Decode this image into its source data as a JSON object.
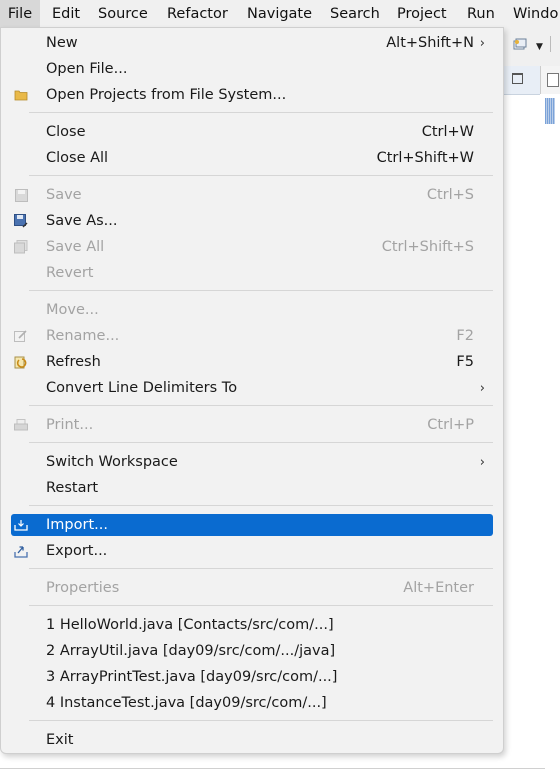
{
  "menubar": {
    "items": [
      "File",
      "Edit",
      "Source",
      "Refactor",
      "Navigate",
      "Search",
      "Project",
      "Run",
      "Windo"
    ]
  },
  "menu": {
    "items": [
      {
        "label": "New",
        "shortcut": "Alt+Shift+N",
        "arrow": "›"
      },
      {
        "label": "Open File..."
      },
      {
        "label": "Open Projects from File System...",
        "icon": "folder-icon"
      },
      {
        "label": "Close",
        "shortcut": "Ctrl+W"
      },
      {
        "label": "Close All",
        "shortcut": "Ctrl+Shift+W"
      },
      {
        "label": "Save",
        "shortcut": "Ctrl+S",
        "icon": "save-icon",
        "disabled": true
      },
      {
        "label": "Save As...",
        "icon": "save-as-icon"
      },
      {
        "label": "Save All",
        "shortcut": "Ctrl+Shift+S",
        "icon": "save-all-icon",
        "disabled": true
      },
      {
        "label": "Revert",
        "disabled": true
      },
      {
        "label": "Move...",
        "disabled": true
      },
      {
        "label": "Rename...",
        "shortcut": "F2",
        "icon": "rename-icon",
        "disabled": true
      },
      {
        "label": "Refresh",
        "shortcut": "F5",
        "icon": "refresh-icon"
      },
      {
        "label": "Convert Line Delimiters To",
        "arrow": "›"
      },
      {
        "label": "Print...",
        "shortcut": "Ctrl+P",
        "icon": "print-icon",
        "disabled": true
      },
      {
        "label": "Switch Workspace",
        "arrow": "›"
      },
      {
        "label": "Restart"
      },
      {
        "label": "Import...",
        "icon": "import-icon",
        "highlighted": true
      },
      {
        "label": "Export...",
        "icon": "export-icon"
      },
      {
        "label": "Properties",
        "shortcut": "Alt+Enter",
        "disabled": true
      },
      {
        "label": "1 HelloWorld.java  [Contacts/src/com/...]"
      },
      {
        "label": "2 ArrayUtil.java  [day09/src/com/.../java]"
      },
      {
        "label": "3 ArrayPrintTest.java  [day09/src/com/...]"
      },
      {
        "label": "4 InstanceTest.java  [day09/src/com/...]"
      },
      {
        "label": "Exit"
      }
    ]
  },
  "colors": {
    "highlight": "#0a6bd0",
    "disabled_text": "#a3a3a3",
    "menu_bg": "#f2f2f2"
  }
}
